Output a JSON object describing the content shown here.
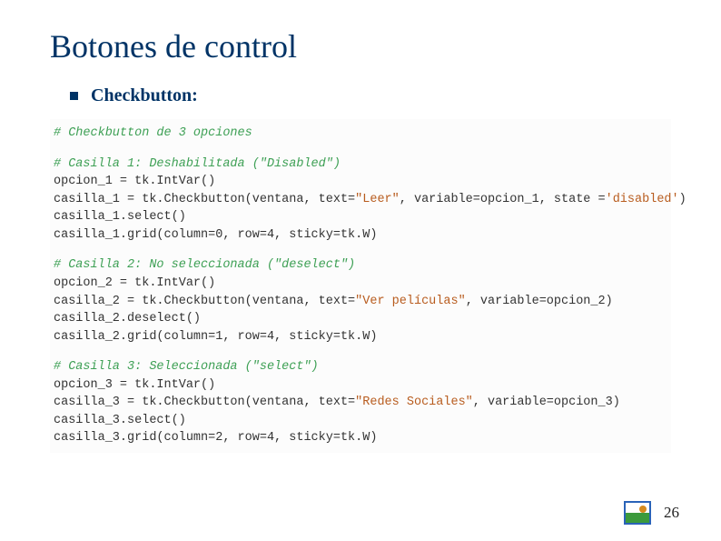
{
  "title": "Botones de control",
  "subtitle": "Checkbutton:",
  "code": [
    {
      "t": "comment",
      "text": "# Checkbutton de 3 opciones"
    },
    {
      "t": "blank"
    },
    {
      "t": "comment",
      "text": "# Casilla 1: Deshabilitada (\"Disabled\")"
    },
    {
      "t": "code",
      "segs": [
        [
          "p",
          "opcion_1 = tk.IntVar()"
        ]
      ]
    },
    {
      "t": "code",
      "segs": [
        [
          "p",
          "casilla_1 = tk.Checkbutton(ventana, text="
        ],
        [
          "s",
          "\"Leer\""
        ],
        [
          "p",
          ", variable=opcion_1, state ="
        ],
        [
          "s",
          "'disabled'"
        ],
        [
          "p",
          ")"
        ]
      ]
    },
    {
      "t": "code",
      "segs": [
        [
          "p",
          "casilla_1.select()"
        ]
      ]
    },
    {
      "t": "code",
      "segs": [
        [
          "p",
          "casilla_1.grid(column=0, row=4, sticky=tk.W)"
        ]
      ]
    },
    {
      "t": "blank"
    },
    {
      "t": "comment",
      "text": "# Casilla 2: No seleccionada (\"deselect\")"
    },
    {
      "t": "code",
      "segs": [
        [
          "p",
          "opcion_2 = tk.IntVar()"
        ]
      ]
    },
    {
      "t": "code",
      "segs": [
        [
          "p",
          "casilla_2 = tk.Checkbutton(ventana, text="
        ],
        [
          "s",
          "\"Ver películas\""
        ],
        [
          "p",
          ", variable=opcion_2)"
        ]
      ]
    },
    {
      "t": "code",
      "segs": [
        [
          "p",
          "casilla_2.deselect()"
        ]
      ]
    },
    {
      "t": "code",
      "segs": [
        [
          "p",
          "casilla_2.grid(column=1, row=4, sticky=tk.W)"
        ]
      ]
    },
    {
      "t": "blank"
    },
    {
      "t": "comment",
      "text": "# Casilla 3: Seleccionada (\"select\")"
    },
    {
      "t": "code",
      "segs": [
        [
          "p",
          "opcion_3 = tk.IntVar()"
        ]
      ]
    },
    {
      "t": "code",
      "segs": [
        [
          "p",
          "casilla_3 = tk.Checkbutton(ventana, text="
        ],
        [
          "s",
          "\"Redes Sociales\""
        ],
        [
          "p",
          ", variable=opcion_3)"
        ]
      ]
    },
    {
      "t": "code",
      "segs": [
        [
          "p",
          "casilla_3.select()"
        ]
      ]
    },
    {
      "t": "code",
      "segs": [
        [
          "p",
          "casilla_3.grid(column=2, row=4, sticky=tk.W)"
        ]
      ]
    }
  ],
  "page_number": "26"
}
